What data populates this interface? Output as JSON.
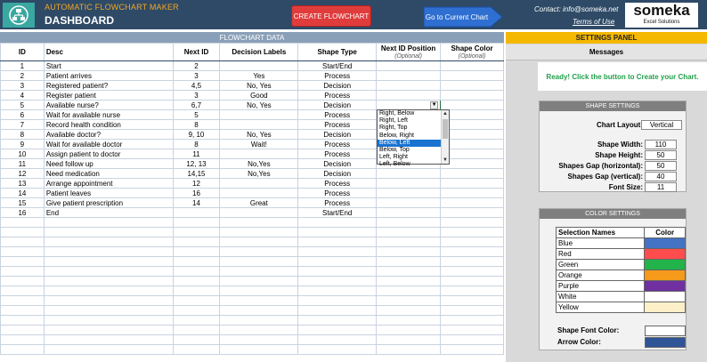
{
  "header": {
    "app_name": "AUTOMATIC FLOWCHART MAKER",
    "page_title": "DASHBOARD",
    "create_button": "CREATE FLOWCHART",
    "goto_button": "Go to Current Chart",
    "contact": "Contact: info@someka.net",
    "terms": "Terms of Use",
    "brand_name": "someka",
    "brand_sub": "Excel Solutions"
  },
  "table": {
    "title": "FLOWCHART DATA",
    "columns": {
      "id": "ID",
      "desc": "Desc",
      "next_id": "Next ID",
      "decision": "Decision Labels",
      "shape": "Shape Type",
      "next_pos": "Next ID Position",
      "next_pos_sub": "(Optional)",
      "shape_color": "Shape Color",
      "shape_color_sub": "(Optional)"
    },
    "rows": [
      {
        "id": "1",
        "desc": "Start",
        "next": "2",
        "label": "",
        "shape": "Start/End"
      },
      {
        "id": "2",
        "desc": "Patient arrives",
        "next": "3",
        "label": "Yes",
        "shape": "Process"
      },
      {
        "id": "3",
        "desc": "Registered patient?",
        "next": "4,5",
        "label": "No, Yes",
        "shape": "Decision"
      },
      {
        "id": "4",
        "desc": "Register patient",
        "next": "3",
        "label": "Good",
        "shape": "Process"
      },
      {
        "id": "5",
        "desc": "Available nurse?",
        "next": "6,7",
        "label": "No, Yes",
        "shape": "Decision"
      },
      {
        "id": "6",
        "desc": "Wait for available nurse",
        "next": "5",
        "label": "",
        "shape": "Process"
      },
      {
        "id": "7",
        "desc": "Record health condition",
        "next": "8",
        "label": "",
        "shape": "Process"
      },
      {
        "id": "8",
        "desc": "Available doctor?",
        "next": "9, 10",
        "label": "No, Yes",
        "shape": "Decision"
      },
      {
        "id": "9",
        "desc": "Wait for available doctor",
        "next": "8",
        "label": "Wait!",
        "shape": "Process"
      },
      {
        "id": "10",
        "desc": "Assign patient to doctor",
        "next": "11",
        "label": "",
        "shape": "Process"
      },
      {
        "id": "11",
        "desc": "Need follow up",
        "next": "12, 13",
        "label": "No,Yes",
        "shape": "Decision"
      },
      {
        "id": "12",
        "desc": "Need medication",
        "next": "14,15",
        "label": "No,Yes",
        "shape": "Decision"
      },
      {
        "id": "13",
        "desc": "Arrange appointment",
        "next": "12",
        "label": "",
        "shape": "Process"
      },
      {
        "id": "14",
        "desc": "Patient leaves",
        "next": "16",
        "label": "",
        "shape": "Process"
      },
      {
        "id": "15",
        "desc": "Give patient prescription",
        "next": "14",
        "label": "Great",
        "shape": "Process"
      },
      {
        "id": "16",
        "desc": "End",
        "next": "",
        "label": "",
        "shape": "Start/End"
      }
    ]
  },
  "dropdown": {
    "options": [
      "Right, Below",
      "Right, Left",
      "Right, Top",
      "Below, Right",
      "Below, Left",
      "Below, Top",
      "Left, Right",
      "Left, Below"
    ],
    "selected": "Below, Left"
  },
  "panel": {
    "title": "SETTINGS PANEL",
    "messages_title": "Messages",
    "message": "Ready! Click the button to Create your Chart.",
    "shape_settings": {
      "title": "SHAPE SETTINGS",
      "chart_layout_label": "Chart Layout:",
      "chart_layout_value": "Vertical",
      "shape_width_label": "Shape Width:",
      "shape_width_value": "110",
      "shape_height_label": "Shape Height:",
      "shape_height_value": "50",
      "gap_h_label": "Shapes Gap (horizontal):",
      "gap_h_value": "50",
      "gap_v_label": "Shapes Gap (vertical):",
      "gap_v_value": "40",
      "font_size_label": "Font Size:",
      "font_size_value": "11"
    },
    "color_settings": {
      "title": "COLOR SETTINGS",
      "names_header": "Selection Names",
      "color_header": "Color",
      "colors": [
        {
          "name": "Blue",
          "hex": "#4472c4"
        },
        {
          "name": "Red",
          "hex": "#ff4d4d"
        },
        {
          "name": "Green",
          "hex": "#22b34a"
        },
        {
          "name": "Orange",
          "hex": "#f59a1b"
        },
        {
          "name": "Purple",
          "hex": "#7030a0"
        },
        {
          "name": "White",
          "hex": "#ffffff"
        },
        {
          "name": "Yellow",
          "hex": "#fdf0c8"
        }
      ],
      "shape_font_color_label": "Shape Font Color:",
      "shape_font_color": "#ffffff",
      "arrow_color_label": "Arrow Color:",
      "arrow_color": "#2f5597"
    }
  }
}
